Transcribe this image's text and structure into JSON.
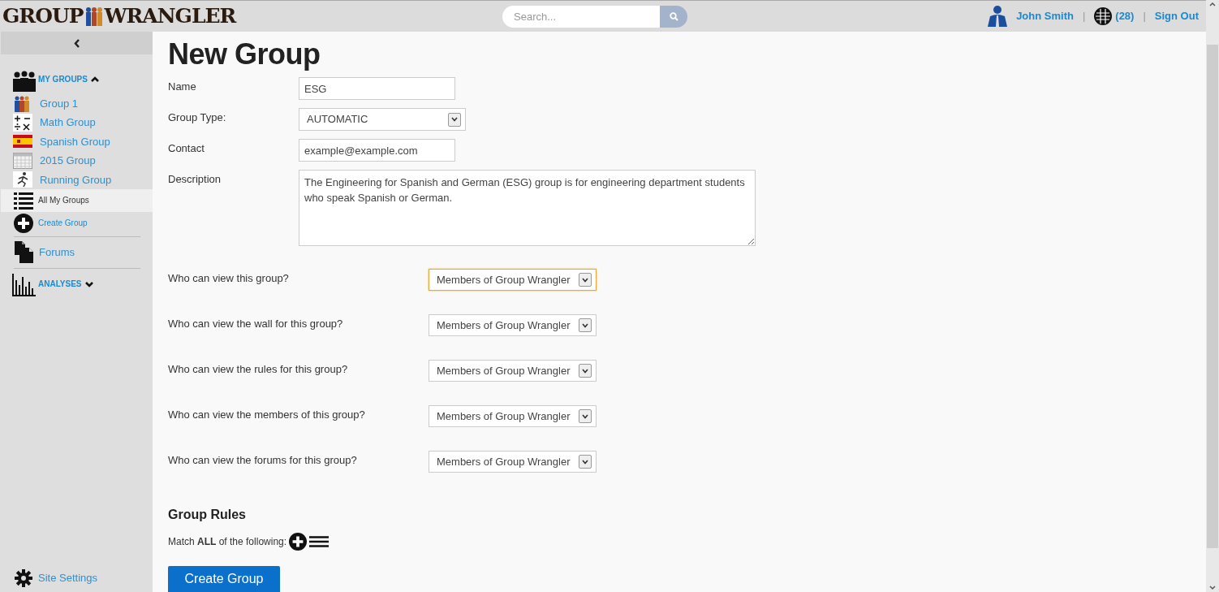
{
  "header": {
    "logo": {
      "left": "GROUP",
      "right": "WRANGLER"
    },
    "search": {
      "placeholder": "Search..."
    },
    "user": "John Smith",
    "separators": [
      "|",
      "|"
    ],
    "notifications": "(28)",
    "sign_out": "Sign Out"
  },
  "sidebar": {
    "my_groups": {
      "label": "MY GROUPS",
      "expanded": true
    },
    "groups": [
      {
        "label": "Group 1",
        "kind": "people"
      },
      {
        "label": "Math Group",
        "kind": "math"
      },
      {
        "label": "Spanish Group",
        "kind": "flag"
      },
      {
        "label": "2015 Group",
        "kind": "calendar"
      },
      {
        "label": "Running Group",
        "kind": "runner"
      }
    ],
    "actions": [
      {
        "label": "All My Groups",
        "kind": "list",
        "selected": true
      },
      {
        "label": "Create Group",
        "kind": "plus",
        "selected": false
      }
    ],
    "forums": "Forums",
    "analyses": {
      "label": "ANALYSES",
      "expanded": false
    },
    "site_settings": "Site Settings"
  },
  "form": {
    "title": "New Group",
    "fields": [
      {
        "label": "Name",
        "kind": "text",
        "value": "ESG"
      },
      {
        "label": "Group Type:",
        "kind": "select",
        "value": "AUTOMATIC"
      },
      {
        "label": "Contact",
        "kind": "text",
        "value": "example@example.com"
      },
      {
        "label": "Description",
        "kind": "textarea",
        "value": "The Engineering for Spanish and German (ESG) group is for engineering department students who speak Spanish or German."
      }
    ],
    "privacy": [
      {
        "label": "Who can view this group?",
        "value": "Members of Group Wrangler",
        "focused": true
      },
      {
        "label": "Who can view the wall for this group?",
        "value": "Members of Group Wrangler",
        "focused": false
      },
      {
        "label": "Who can view the rules for this group?",
        "value": "Members of Group Wrangler",
        "focused": false
      },
      {
        "label": "Who can view the members of this group?",
        "value": "Members of Group Wrangler",
        "focused": false
      },
      {
        "label": "Who can view the forums for this group?",
        "value": "Members of Group Wrangler",
        "focused": false
      }
    ],
    "rules_title": "Group Rules",
    "rules_text": "Match **ALL** of the following:",
    "submit": "Create Group"
  }
}
